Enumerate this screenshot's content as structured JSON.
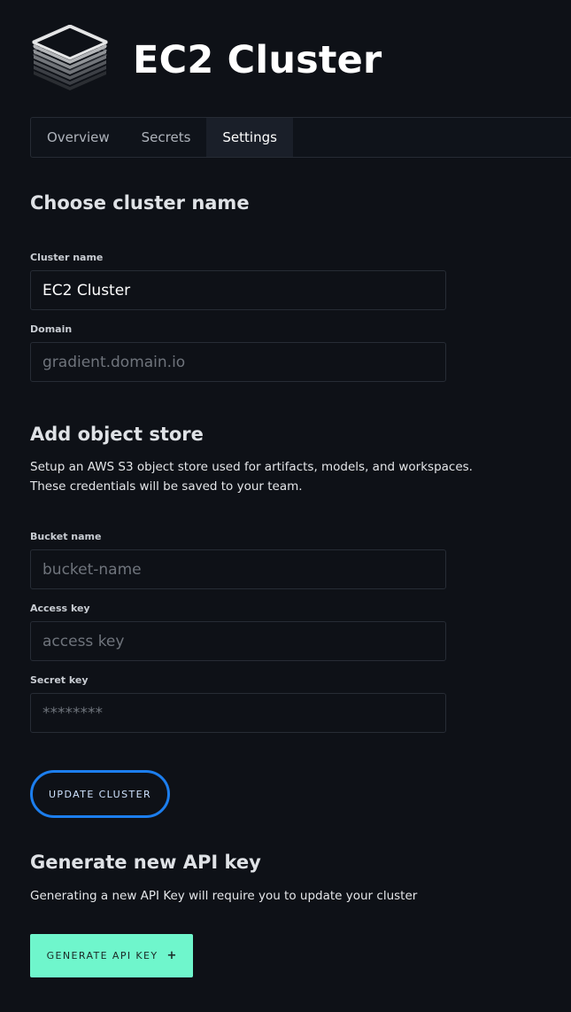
{
  "header": {
    "title": "EC2 Cluster",
    "logo_icon": "stacked-layers-icon"
  },
  "tabs": [
    {
      "label": "Overview",
      "active": false
    },
    {
      "label": "Secrets",
      "active": false
    },
    {
      "label": "Settings",
      "active": true
    }
  ],
  "cluster_name_section": {
    "title": "Choose cluster name",
    "cluster_name": {
      "label": "Cluster name",
      "value": "EC2 Cluster",
      "placeholder": ""
    },
    "domain": {
      "label": "Domain",
      "value": "",
      "placeholder": "gradient.domain.io"
    }
  },
  "object_store_section": {
    "title": "Add object store",
    "description_line1": "Setup an AWS S3 object store used for artifacts, models, and workspaces.",
    "description_line2": "These credentials will be saved to your team.",
    "bucket_name": {
      "label": "Bucket name",
      "value": "",
      "placeholder": "bucket-name"
    },
    "access_key": {
      "label": "Access key",
      "value": "",
      "placeholder": "access key"
    },
    "secret_key": {
      "label": "Secret key",
      "value": "",
      "placeholder": "********"
    }
  },
  "update_button": {
    "label": "UPDATE CLUSTER"
  },
  "api_key_section": {
    "title": "Generate new API key",
    "description": "Generating a new API Key will require you to update your cluster",
    "button_label": "GENERATE API KEY",
    "button_icon": "+"
  },
  "colors": {
    "background": "#0e1117",
    "accent_blue": "#1c7eee",
    "accent_mint": "#6ff6cc"
  }
}
